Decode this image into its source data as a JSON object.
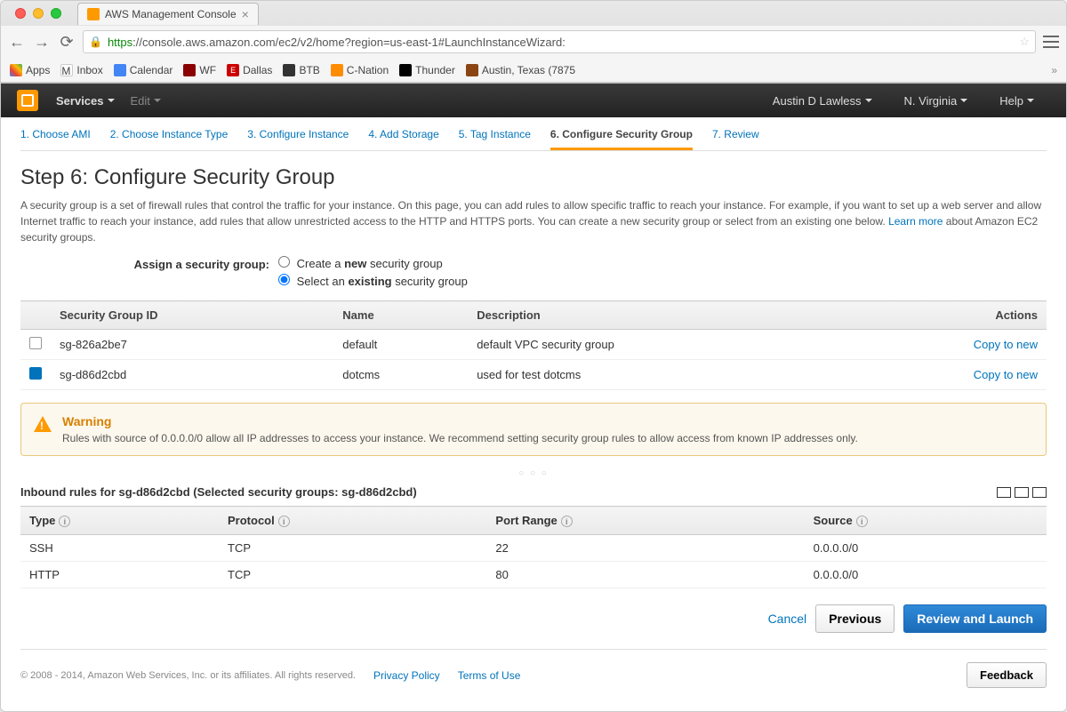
{
  "browser": {
    "tab_title": "AWS Management Console",
    "url_https": "https",
    "url_rest": "://console.aws.amazon.com/ec2/v2/home?region=us-east-1#LaunchInstanceWizard:",
    "bookmarks": {
      "apps": "Apps",
      "inbox": "Inbox",
      "calendar": "Calendar",
      "wf": "WF",
      "dallas": "Dallas",
      "btb": "BTB",
      "cnation": "C-Nation",
      "thunder": "Thunder",
      "austin": "Austin, Texas (7875"
    }
  },
  "nav": {
    "services": "Services",
    "edit": "Edit",
    "user": "Austin D Lawless",
    "region": "N. Virginia",
    "help": "Help"
  },
  "wizard": {
    "step1": "1. Choose AMI",
    "step2": "2. Choose Instance Type",
    "step3": "3. Configure Instance",
    "step4": "4. Add Storage",
    "step5": "5. Tag Instance",
    "step6": "6. Configure Security Group",
    "step7": "7. Review"
  },
  "page": {
    "title": "Step 6: Configure Security Group",
    "description": "A security group is a set of firewall rules that control the traffic for your instance. On this page, you can add rules to allow specific traffic to reach your instance. For example, if you want to set up a web server and allow Internet traffic to reach your instance, add rules that allow unrestricted access to the HTTP and HTTPS ports. You can create a new security group or select from an existing one below. ",
    "learn_more": "Learn more",
    "learn_more_after": " about Amazon EC2 security groups.",
    "assign_label": "Assign a security group:",
    "opt_create_pre": "Create a ",
    "opt_create_bold": "new",
    "opt_create_post": " security group",
    "opt_existing_pre": "Select an ",
    "opt_existing_bold": "existing",
    "opt_existing_post": " security group"
  },
  "sg_table": {
    "headers": {
      "id": "Security Group ID",
      "name": "Name",
      "desc": "Description",
      "actions": "Actions"
    },
    "rows": [
      {
        "checked": false,
        "id": "sg-826a2be7",
        "name": "default",
        "desc": "default VPC security group",
        "action": "Copy to new"
      },
      {
        "checked": true,
        "id": "sg-d86d2cbd",
        "name": "dotcms",
        "desc": "used for test dotcms",
        "action": "Copy to new"
      }
    ]
  },
  "warning": {
    "title": "Warning",
    "text": "Rules with source of 0.0.0.0/0 allow all IP addresses to access your instance. We recommend setting security group rules to allow access from known IP addresses only."
  },
  "inbound": {
    "title": "Inbound rules for sg-d86d2cbd (Selected security groups: sg-d86d2cbd)",
    "headers": {
      "type": "Type",
      "protocol": "Protocol",
      "port": "Port Range",
      "source": "Source"
    },
    "rows": [
      {
        "type": "SSH",
        "protocol": "TCP",
        "port": "22",
        "source": "0.0.0.0/0"
      },
      {
        "type": "HTTP",
        "protocol": "TCP",
        "port": "80",
        "source": "0.0.0.0/0"
      }
    ]
  },
  "buttons": {
    "cancel": "Cancel",
    "previous": "Previous",
    "review": "Review and Launch",
    "feedback": "Feedback"
  },
  "footer": {
    "copyright": "© 2008 - 2014, Amazon Web Services, Inc. or its affiliates. All rights reserved.",
    "privacy": "Privacy Policy",
    "terms": "Terms of Use"
  }
}
